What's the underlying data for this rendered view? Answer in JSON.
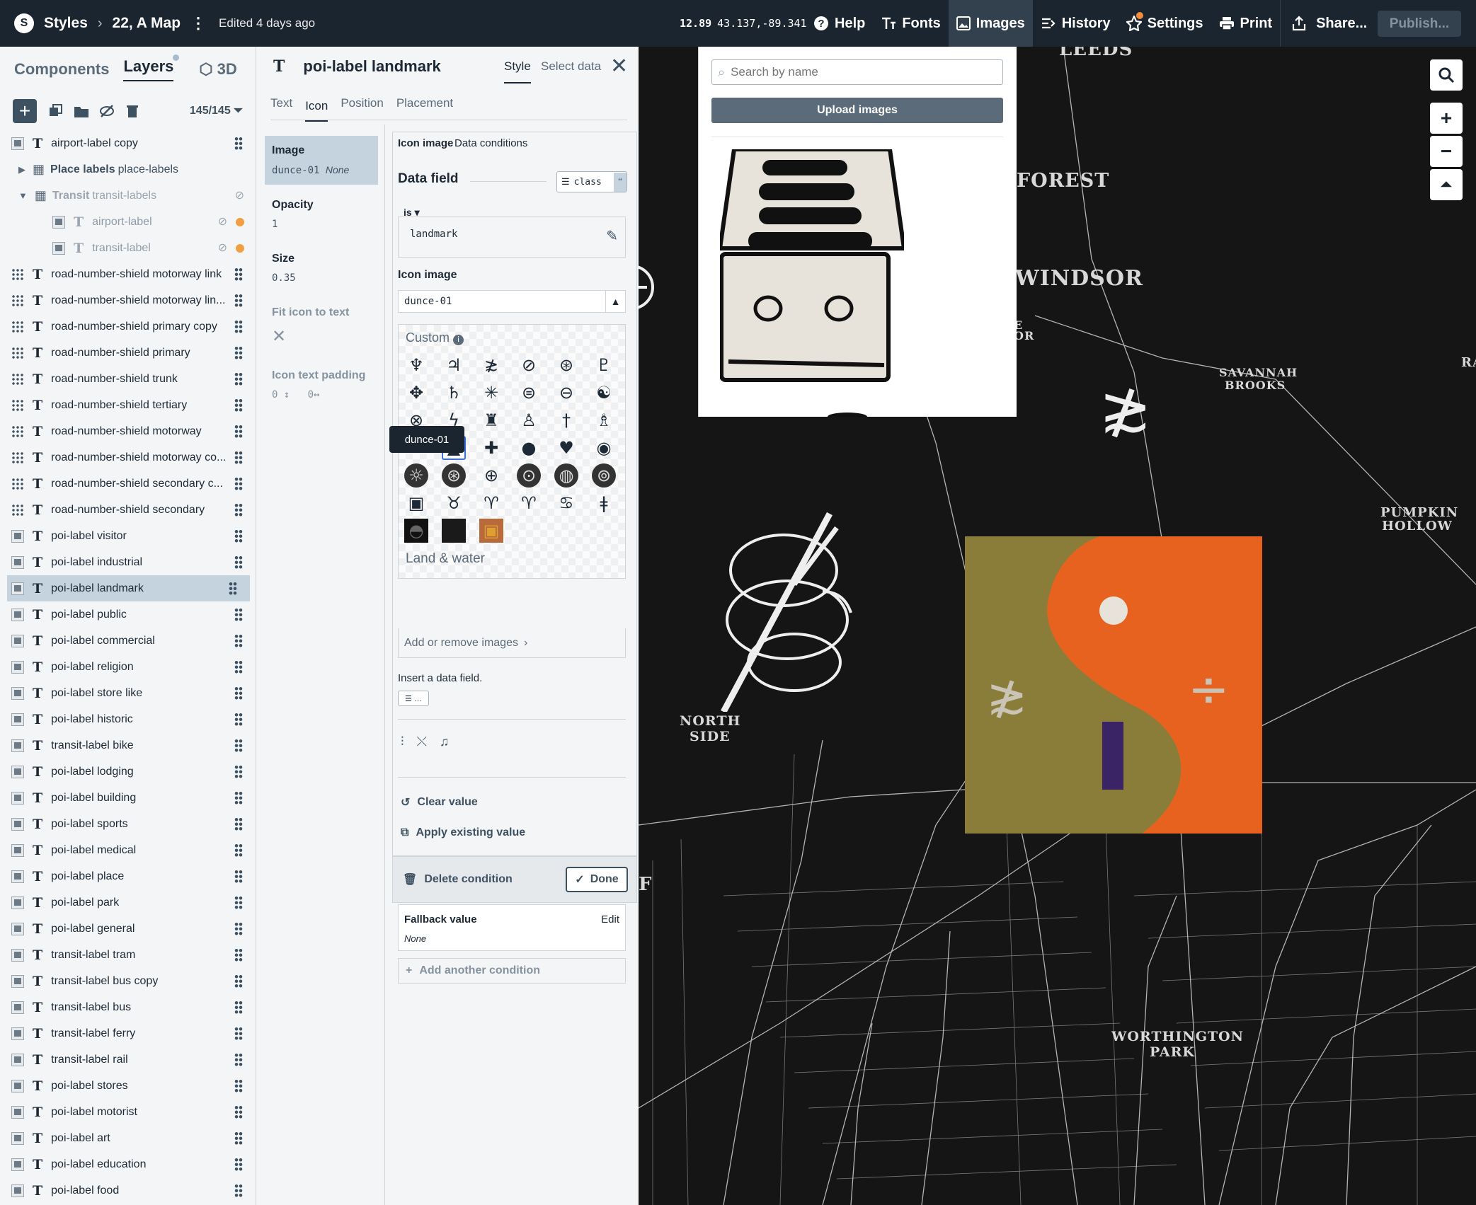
{
  "topbar": {
    "breadcrumb_root": "Styles",
    "breadcrumb_map": "22, A Map",
    "edited": "Edited 4 days ago",
    "zoom": "12.89",
    "coords": "43.137,-89.341",
    "help": "Help",
    "fonts": "Fonts",
    "images": "Images",
    "history": "History",
    "settings": "Settings",
    "print": "Print",
    "share": "Share...",
    "publish": "Publish..."
  },
  "left": {
    "tab_components": "Components",
    "tab_layers": "Layers",
    "tab_3d": "3D",
    "count": "145/145",
    "layers": [
      {
        "label": "airport-label copy"
      },
      {
        "label": "Place labels",
        "sub": "place-labels"
      },
      {
        "label": "Transit",
        "sub": "transit-labels"
      },
      {
        "label": "airport-label"
      },
      {
        "label": "transit-label"
      },
      {
        "label": "road-number-shield motorway link"
      },
      {
        "label": "road-number-shield motorway lin..."
      },
      {
        "label": "road-number-shield primary copy"
      },
      {
        "label": "road-number-shield primary"
      },
      {
        "label": "road-number-shield trunk"
      },
      {
        "label": "road-number-shield tertiary"
      },
      {
        "label": "road-number-shield motorway"
      },
      {
        "label": "road-number-shield motorway co..."
      },
      {
        "label": "road-number-shield secondary c..."
      },
      {
        "label": "road-number-shield secondary"
      },
      {
        "label": "poi-label visitor"
      },
      {
        "label": "poi-label industrial"
      },
      {
        "label": "poi-label landmark"
      },
      {
        "label": "poi-label public"
      },
      {
        "label": "poi-label commercial"
      },
      {
        "label": "poi-label religion"
      },
      {
        "label": "poi-label store like"
      },
      {
        "label": "poi-label historic"
      },
      {
        "label": "transit-label bike"
      },
      {
        "label": "poi-label lodging"
      },
      {
        "label": "poi-label building"
      },
      {
        "label": "poi-label sports"
      },
      {
        "label": "poi-label medical"
      },
      {
        "label": "poi-label place"
      },
      {
        "label": "poi-label park"
      },
      {
        "label": "poi-label general"
      },
      {
        "label": "transit-label tram"
      },
      {
        "label": "transit-label bus copy"
      },
      {
        "label": "transit-label bus"
      },
      {
        "label": "transit-label ferry"
      },
      {
        "label": "transit-label rail"
      },
      {
        "label": "poi-label stores"
      },
      {
        "label": "poi-label motorist"
      },
      {
        "label": "poi-label art"
      },
      {
        "label": "poi-label education"
      },
      {
        "label": "poi-label food"
      }
    ]
  },
  "mid": {
    "title": "poi-label landmark",
    "tab_style": "Style",
    "tab_select": "Select data",
    "subtabs": [
      "Text",
      "Icon",
      "Position",
      "Placement"
    ],
    "props": {
      "image_label": "Image",
      "image_value": "dunce-01",
      "image_none": "None",
      "opacity_label": "Opacity",
      "opacity_value": "1",
      "size_label": "Size",
      "size_value": "0.35",
      "fit_label": "Fit icon to text",
      "padding_label": "Icon text padding",
      "padding_v": "0",
      "padding_h": "0"
    },
    "cond": {
      "tab_icon_image": "Icon image",
      "tab_data_conditions": "Data conditions",
      "data_field": "Data field",
      "class_chip": "class",
      "is": "is",
      "is_value": "landmark",
      "icon_image_label": "Icon image",
      "icon_image_value": "dunce-01",
      "custom": "Custom",
      "tooltip": "dunce-01",
      "land_water": "Land & water",
      "add_remove": "Add or remove images",
      "insert": "Insert a data field.",
      "clear": "Clear value",
      "apply": "Apply existing value",
      "delete": "Delete condition",
      "done": "Done",
      "fallback_label": "Fallback value",
      "fallback_edit": "Edit",
      "fallback_value": "None",
      "add_another": "Add another condition"
    }
  },
  "images_popover": {
    "search_placeholder": "Search by name",
    "upload": "Upload images"
  },
  "map": {
    "labels": [
      "LEEDS",
      "FOREST",
      "WINDSOR",
      "E",
      "OR",
      "SAVANNAH",
      "BROOKS",
      "RA",
      "PUMPKIN",
      "HOLLOW",
      "NORTH",
      "SIDE",
      "WORTHINGTON",
      "PARK",
      "F"
    ],
    "colors": {
      "olive": "#8a7d3a",
      "orange": "#e8621f",
      "purple": "#3a2466",
      "cream": "#e8e3da"
    }
  }
}
